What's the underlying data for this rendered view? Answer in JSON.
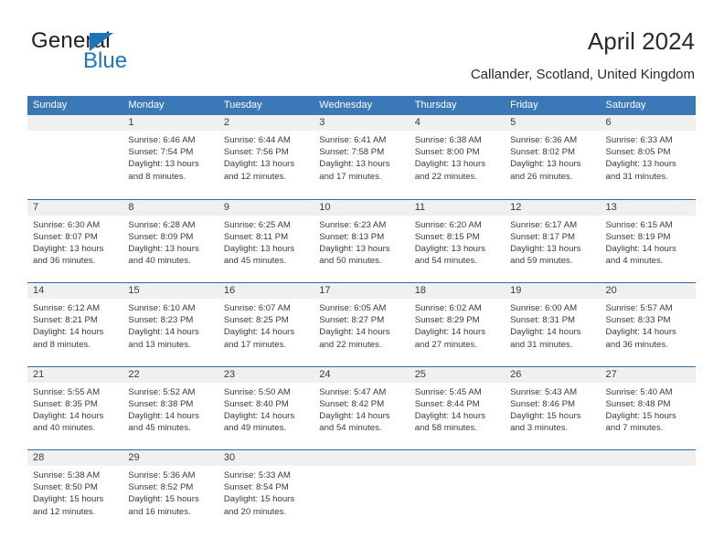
{
  "brand": {
    "name_part1": "General",
    "name_part2": "Blue",
    "triangle_color": "#1b75bb",
    "text_color": "#231f20",
    "blue_color": "#1b75bb"
  },
  "header": {
    "title": "April 2024",
    "subtitle": "Callander, Scotland, United Kingdom"
  },
  "calendar": {
    "header_bg": "#3b78b8",
    "row_divider": "#2e6ca4",
    "daynum_band": "#f0f0f0",
    "weekdays": [
      "Sunday",
      "Monday",
      "Tuesday",
      "Wednesday",
      "Thursday",
      "Friday",
      "Saturday"
    ],
    "weeks": [
      [
        {
          "day": ""
        },
        {
          "day": "1",
          "sunrise": "Sunrise: 6:46 AM",
          "sunset": "Sunset: 7:54 PM",
          "daylight_line1": "Daylight: 13 hours",
          "daylight_line2": "and 8 minutes."
        },
        {
          "day": "2",
          "sunrise": "Sunrise: 6:44 AM",
          "sunset": "Sunset: 7:56 PM",
          "daylight_line1": "Daylight: 13 hours",
          "daylight_line2": "and 12 minutes."
        },
        {
          "day": "3",
          "sunrise": "Sunrise: 6:41 AM",
          "sunset": "Sunset: 7:58 PM",
          "daylight_line1": "Daylight: 13 hours",
          "daylight_line2": "and 17 minutes."
        },
        {
          "day": "4",
          "sunrise": "Sunrise: 6:38 AM",
          "sunset": "Sunset: 8:00 PM",
          "daylight_line1": "Daylight: 13 hours",
          "daylight_line2": "and 22 minutes."
        },
        {
          "day": "5",
          "sunrise": "Sunrise: 6:36 AM",
          "sunset": "Sunset: 8:02 PM",
          "daylight_line1": "Daylight: 13 hours",
          "daylight_line2": "and 26 minutes."
        },
        {
          "day": "6",
          "sunrise": "Sunrise: 6:33 AM",
          "sunset": "Sunset: 8:05 PM",
          "daylight_line1": "Daylight: 13 hours",
          "daylight_line2": "and 31 minutes."
        }
      ],
      [
        {
          "day": "7",
          "sunrise": "Sunrise: 6:30 AM",
          "sunset": "Sunset: 8:07 PM",
          "daylight_line1": "Daylight: 13 hours",
          "daylight_line2": "and 36 minutes."
        },
        {
          "day": "8",
          "sunrise": "Sunrise: 6:28 AM",
          "sunset": "Sunset: 8:09 PM",
          "daylight_line1": "Daylight: 13 hours",
          "daylight_line2": "and 40 minutes."
        },
        {
          "day": "9",
          "sunrise": "Sunrise: 6:25 AM",
          "sunset": "Sunset: 8:11 PM",
          "daylight_line1": "Daylight: 13 hours",
          "daylight_line2": "and 45 minutes."
        },
        {
          "day": "10",
          "sunrise": "Sunrise: 6:23 AM",
          "sunset": "Sunset: 8:13 PM",
          "daylight_line1": "Daylight: 13 hours",
          "daylight_line2": "and 50 minutes."
        },
        {
          "day": "11",
          "sunrise": "Sunrise: 6:20 AM",
          "sunset": "Sunset: 8:15 PM",
          "daylight_line1": "Daylight: 13 hours",
          "daylight_line2": "and 54 minutes."
        },
        {
          "day": "12",
          "sunrise": "Sunrise: 6:17 AM",
          "sunset": "Sunset: 8:17 PM",
          "daylight_line1": "Daylight: 13 hours",
          "daylight_line2": "and 59 minutes."
        },
        {
          "day": "13",
          "sunrise": "Sunrise: 6:15 AM",
          "sunset": "Sunset: 8:19 PM",
          "daylight_line1": "Daylight: 14 hours",
          "daylight_line2": "and 4 minutes."
        }
      ],
      [
        {
          "day": "14",
          "sunrise": "Sunrise: 6:12 AM",
          "sunset": "Sunset: 8:21 PM",
          "daylight_line1": "Daylight: 14 hours",
          "daylight_line2": "and 8 minutes."
        },
        {
          "day": "15",
          "sunrise": "Sunrise: 6:10 AM",
          "sunset": "Sunset: 8:23 PM",
          "daylight_line1": "Daylight: 14 hours",
          "daylight_line2": "and 13 minutes."
        },
        {
          "day": "16",
          "sunrise": "Sunrise: 6:07 AM",
          "sunset": "Sunset: 8:25 PM",
          "daylight_line1": "Daylight: 14 hours",
          "daylight_line2": "and 17 minutes."
        },
        {
          "day": "17",
          "sunrise": "Sunrise: 6:05 AM",
          "sunset": "Sunset: 8:27 PM",
          "daylight_line1": "Daylight: 14 hours",
          "daylight_line2": "and 22 minutes."
        },
        {
          "day": "18",
          "sunrise": "Sunrise: 6:02 AM",
          "sunset": "Sunset: 8:29 PM",
          "daylight_line1": "Daylight: 14 hours",
          "daylight_line2": "and 27 minutes."
        },
        {
          "day": "19",
          "sunrise": "Sunrise: 6:00 AM",
          "sunset": "Sunset: 8:31 PM",
          "daylight_line1": "Daylight: 14 hours",
          "daylight_line2": "and 31 minutes."
        },
        {
          "day": "20",
          "sunrise": "Sunrise: 5:57 AM",
          "sunset": "Sunset: 8:33 PM",
          "daylight_line1": "Daylight: 14 hours",
          "daylight_line2": "and 36 minutes."
        }
      ],
      [
        {
          "day": "21",
          "sunrise": "Sunrise: 5:55 AM",
          "sunset": "Sunset: 8:35 PM",
          "daylight_line1": "Daylight: 14 hours",
          "daylight_line2": "and 40 minutes."
        },
        {
          "day": "22",
          "sunrise": "Sunrise: 5:52 AM",
          "sunset": "Sunset: 8:38 PM",
          "daylight_line1": "Daylight: 14 hours",
          "daylight_line2": "and 45 minutes."
        },
        {
          "day": "23",
          "sunrise": "Sunrise: 5:50 AM",
          "sunset": "Sunset: 8:40 PM",
          "daylight_line1": "Daylight: 14 hours",
          "daylight_line2": "and 49 minutes."
        },
        {
          "day": "24",
          "sunrise": "Sunrise: 5:47 AM",
          "sunset": "Sunset: 8:42 PM",
          "daylight_line1": "Daylight: 14 hours",
          "daylight_line2": "and 54 minutes."
        },
        {
          "day": "25",
          "sunrise": "Sunrise: 5:45 AM",
          "sunset": "Sunset: 8:44 PM",
          "daylight_line1": "Daylight: 14 hours",
          "daylight_line2": "and 58 minutes."
        },
        {
          "day": "26",
          "sunrise": "Sunrise: 5:43 AM",
          "sunset": "Sunset: 8:46 PM",
          "daylight_line1": "Daylight: 15 hours",
          "daylight_line2": "and 3 minutes."
        },
        {
          "day": "27",
          "sunrise": "Sunrise: 5:40 AM",
          "sunset": "Sunset: 8:48 PM",
          "daylight_line1": "Daylight: 15 hours",
          "daylight_line2": "and 7 minutes."
        }
      ],
      [
        {
          "day": "28",
          "sunrise": "Sunrise: 5:38 AM",
          "sunset": "Sunset: 8:50 PM",
          "daylight_line1": "Daylight: 15 hours",
          "daylight_line2": "and 12 minutes."
        },
        {
          "day": "29",
          "sunrise": "Sunrise: 5:36 AM",
          "sunset": "Sunset: 8:52 PM",
          "daylight_line1": "Daylight: 15 hours",
          "daylight_line2": "and 16 minutes."
        },
        {
          "day": "30",
          "sunrise": "Sunrise: 5:33 AM",
          "sunset": "Sunset: 8:54 PM",
          "daylight_line1": "Daylight: 15 hours",
          "daylight_line2": "and 20 minutes."
        },
        {
          "day": ""
        },
        {
          "day": ""
        },
        {
          "day": ""
        },
        {
          "day": ""
        }
      ]
    ]
  }
}
